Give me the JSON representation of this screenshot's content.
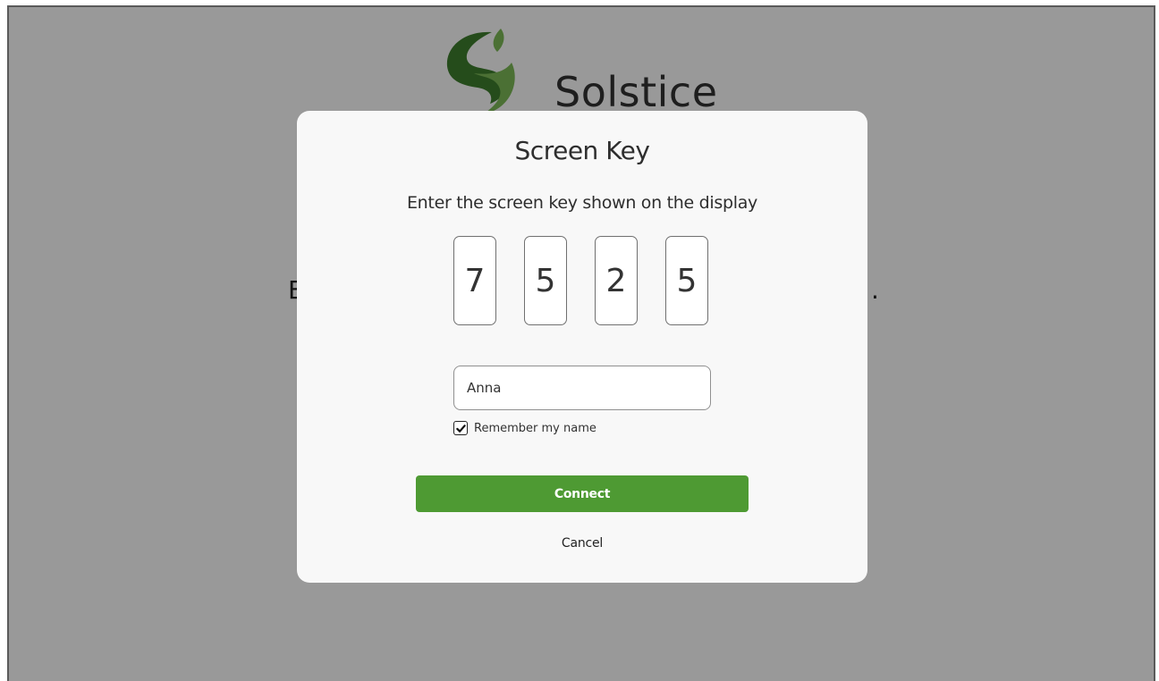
{
  "background": {
    "brand_name": "Solstice",
    "partial_text_left": "E",
    "partial_text_right": "."
  },
  "dialog": {
    "title": "Screen Key",
    "instructions": "Enter the screen key shown on the display",
    "screen_key": [
      "7",
      "5",
      "2",
      "5"
    ],
    "name_value": "Anna",
    "remember_label": "Remember my name",
    "remember_checked": true,
    "connect_label": "Connect",
    "cancel_label": "Cancel"
  },
  "colors": {
    "accent": "#4e9a33",
    "logo_green_dark": "#3f7f2e",
    "logo_green_light": "#7dbb57",
    "overlay": "rgba(0,0,0,0.40)",
    "modal_bg": "#f8f8f8"
  },
  "icons": {
    "logo": "solstice-s-leaf-logo",
    "checkbox": "checkmark-icon"
  }
}
